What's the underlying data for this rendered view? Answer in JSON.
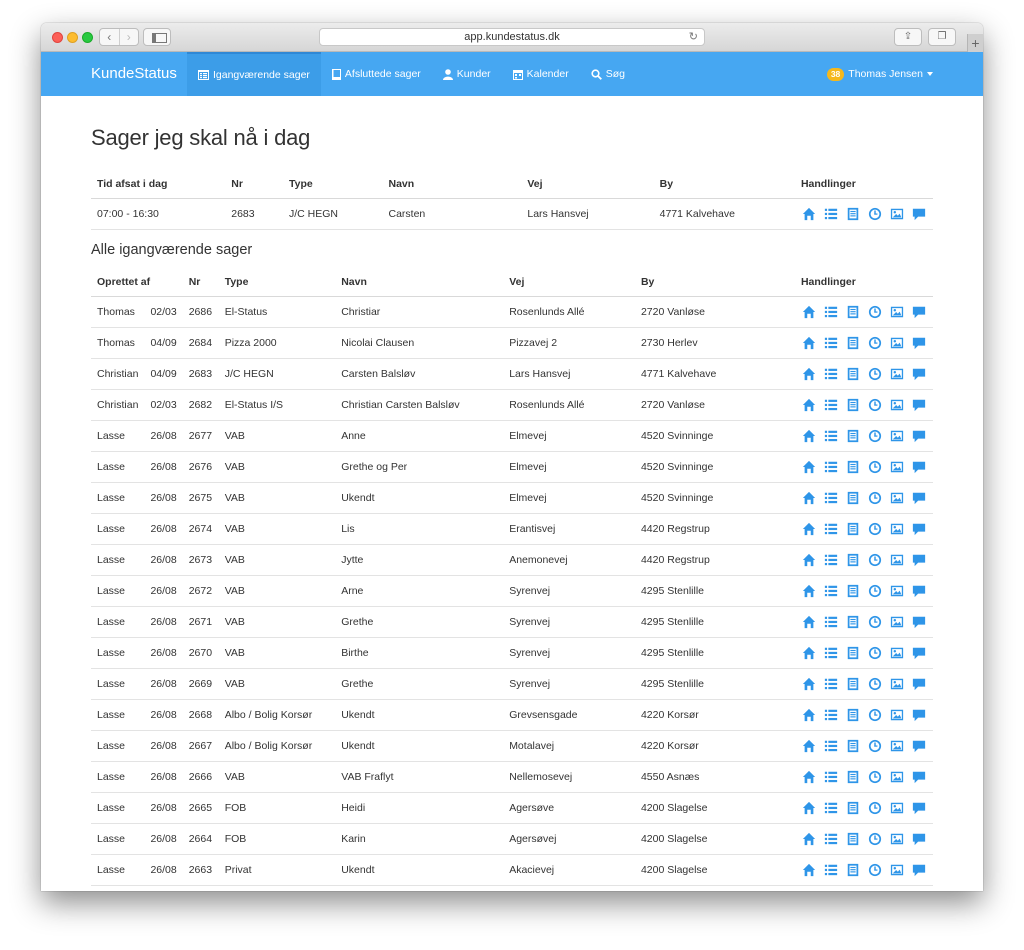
{
  "browser": {
    "url": "app.kundestatus.dk"
  },
  "nav": {
    "brand": "KundeStatus",
    "items": [
      {
        "label": "Igangværende sager",
        "icon": "list-alt-icon",
        "active": true
      },
      {
        "label": "Afsluttede sager",
        "icon": "book-icon",
        "active": false
      },
      {
        "label": "Kunder",
        "icon": "user-icon",
        "active": false
      },
      {
        "label": "Kalender",
        "icon": "calendar-icon",
        "active": false
      },
      {
        "label": "Søg",
        "icon": "search-icon",
        "active": false
      }
    ],
    "user_badge": "38",
    "user_name": "Thomas Jensen"
  },
  "today": {
    "title": "Sager jeg skal nå i dag",
    "headers": [
      "Tid afsat i dag",
      "Nr",
      "Type",
      "Navn",
      "Vej",
      "By",
      "Handlinger"
    ],
    "rows": [
      {
        "tid": "07:00 - 16:30",
        "nr": "2683",
        "type": "J/C HEGN",
        "navn": "Carsten",
        "vej": "Lars Hansvej",
        "by": "4771 Kalvehave"
      }
    ]
  },
  "ongoing": {
    "title": "Alle igangværende sager",
    "headers": [
      "Oprettet af",
      "Nr",
      "Type",
      "Navn",
      "Vej",
      "By",
      "Handlinger"
    ],
    "rows": [
      {
        "af": "Thomas",
        "dato": "02/03",
        "nr": "2686",
        "type": "El-Status",
        "navn": "Christiar",
        "vej": "Rosenlunds Allé",
        "by": "2720 Vanløse"
      },
      {
        "af": "Thomas",
        "dato": "04/09",
        "nr": "2684",
        "type": "Pizza 2000",
        "navn": "Nicolai Clausen",
        "vej": "Pizzavej 2",
        "by": "2730 Herlev"
      },
      {
        "af": "Christian",
        "dato": "04/09",
        "nr": "2683",
        "type": "J/C HEGN",
        "navn": "Carsten Balsløv",
        "vej": "Lars Hansvej",
        "by": "4771 Kalvehave"
      },
      {
        "af": "Christian",
        "dato": "02/03",
        "nr": "2682",
        "type": "El-Status I/S",
        "navn": "Christian Carsten Balsløv",
        "vej": "Rosenlunds Allé",
        "by": "2720 Vanløse"
      },
      {
        "af": "Lasse",
        "dato": "26/08",
        "nr": "2677",
        "type": "VAB",
        "navn": "Anne",
        "vej": "Elmevej",
        "by": "4520 Svinninge"
      },
      {
        "af": "Lasse",
        "dato": "26/08",
        "nr": "2676",
        "type": "VAB",
        "navn": "Grethe og Per",
        "vej": "Elmevej",
        "by": "4520 Svinninge"
      },
      {
        "af": "Lasse",
        "dato": "26/08",
        "nr": "2675",
        "type": "VAB",
        "navn": "Ukendt",
        "vej": "Elmevej",
        "by": "4520 Svinninge"
      },
      {
        "af": "Lasse",
        "dato": "26/08",
        "nr": "2674",
        "type": "VAB",
        "navn": "Lis",
        "vej": "Erantisvej",
        "by": "4420 Regstrup"
      },
      {
        "af": "Lasse",
        "dato": "26/08",
        "nr": "2673",
        "type": "VAB",
        "navn": "Jytte",
        "vej": "Anemonevej",
        "by": "4420 Regstrup"
      },
      {
        "af": "Lasse",
        "dato": "26/08",
        "nr": "2672",
        "type": "VAB",
        "navn": "Arne",
        "vej": "Syrenvej",
        "by": "4295 Stenlille"
      },
      {
        "af": "Lasse",
        "dato": "26/08",
        "nr": "2671",
        "type": "VAB",
        "navn": "Grethe",
        "vej": "Syrenvej",
        "by": "4295 Stenlille"
      },
      {
        "af": "Lasse",
        "dato": "26/08",
        "nr": "2670",
        "type": "VAB",
        "navn": "Birthe",
        "vej": "Syrenvej",
        "by": "4295 Stenlille"
      },
      {
        "af": "Lasse",
        "dato": "26/08",
        "nr": "2669",
        "type": "VAB",
        "navn": "Grethe",
        "vej": "Syrenvej",
        "by": "4295 Stenlille"
      },
      {
        "af": "Lasse",
        "dato": "26/08",
        "nr": "2668",
        "type": "Albo / Bolig Korsør",
        "navn": "Ukendt",
        "vej": "Grevsensgade",
        "by": "4220 Korsør"
      },
      {
        "af": "Lasse",
        "dato": "26/08",
        "nr": "2667",
        "type": "Albo / Bolig Korsør",
        "navn": "Ukendt",
        "vej": "Motalavej",
        "by": "4220 Korsør"
      },
      {
        "af": "Lasse",
        "dato": "26/08",
        "nr": "2666",
        "type": "VAB",
        "navn": "VAB Fraflyt",
        "vej": "Nellemosevej",
        "by": "4550 Asnæs"
      },
      {
        "af": "Lasse",
        "dato": "26/08",
        "nr": "2665",
        "type": "FOB",
        "navn": "Heidi",
        "vej": "Agersøve",
        "by": "4200 Slagelse"
      },
      {
        "af": "Lasse",
        "dato": "26/08",
        "nr": "2664",
        "type": "FOB",
        "navn": "Karin",
        "vej": "Agersøvej",
        "by": "4200 Slagelse"
      },
      {
        "af": "Lasse",
        "dato": "26/08",
        "nr": "2663",
        "type": "Privat",
        "navn": "Ukendt",
        "vej": "Akacievej",
        "by": "4200 Slagelse"
      }
    ]
  },
  "action_icons": [
    "home-icon",
    "list-icon",
    "document-icon",
    "clock-icon",
    "image-icon",
    "comment-icon"
  ],
  "colors": {
    "nav_bg": "#46a7f2",
    "icon": "#2e95e8",
    "badge": "#f5b81c"
  }
}
